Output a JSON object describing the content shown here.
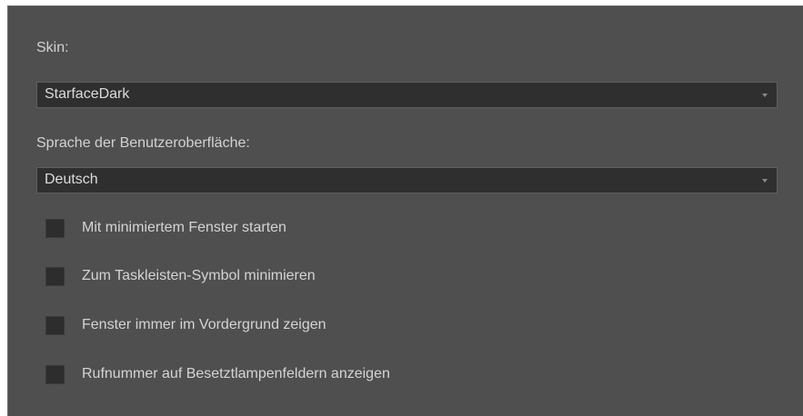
{
  "skin": {
    "label": "Skin:",
    "selected": "StarfaceDark",
    "arrow_icon": "chevron-down-icon"
  },
  "language": {
    "label": "Sprache der Benutzeroberfläche:",
    "selected": "Deutsch",
    "arrow_icon": "chevron-down-icon"
  },
  "options": [
    {
      "label": "Mit minimiertem Fenster starten",
      "checked": false
    },
    {
      "label": "Zum Taskleisten-Symbol minimieren",
      "checked": false
    },
    {
      "label": "Fenster immer im Vordergrund zeigen",
      "checked": false
    },
    {
      "label": "Rufnummer auf Besetztlampenfeldern anzeigen",
      "checked": false
    }
  ],
  "colors": {
    "panel_background": "#4f4f4f",
    "field_background": "#2f2f2f",
    "text": "#d4d4d4"
  }
}
